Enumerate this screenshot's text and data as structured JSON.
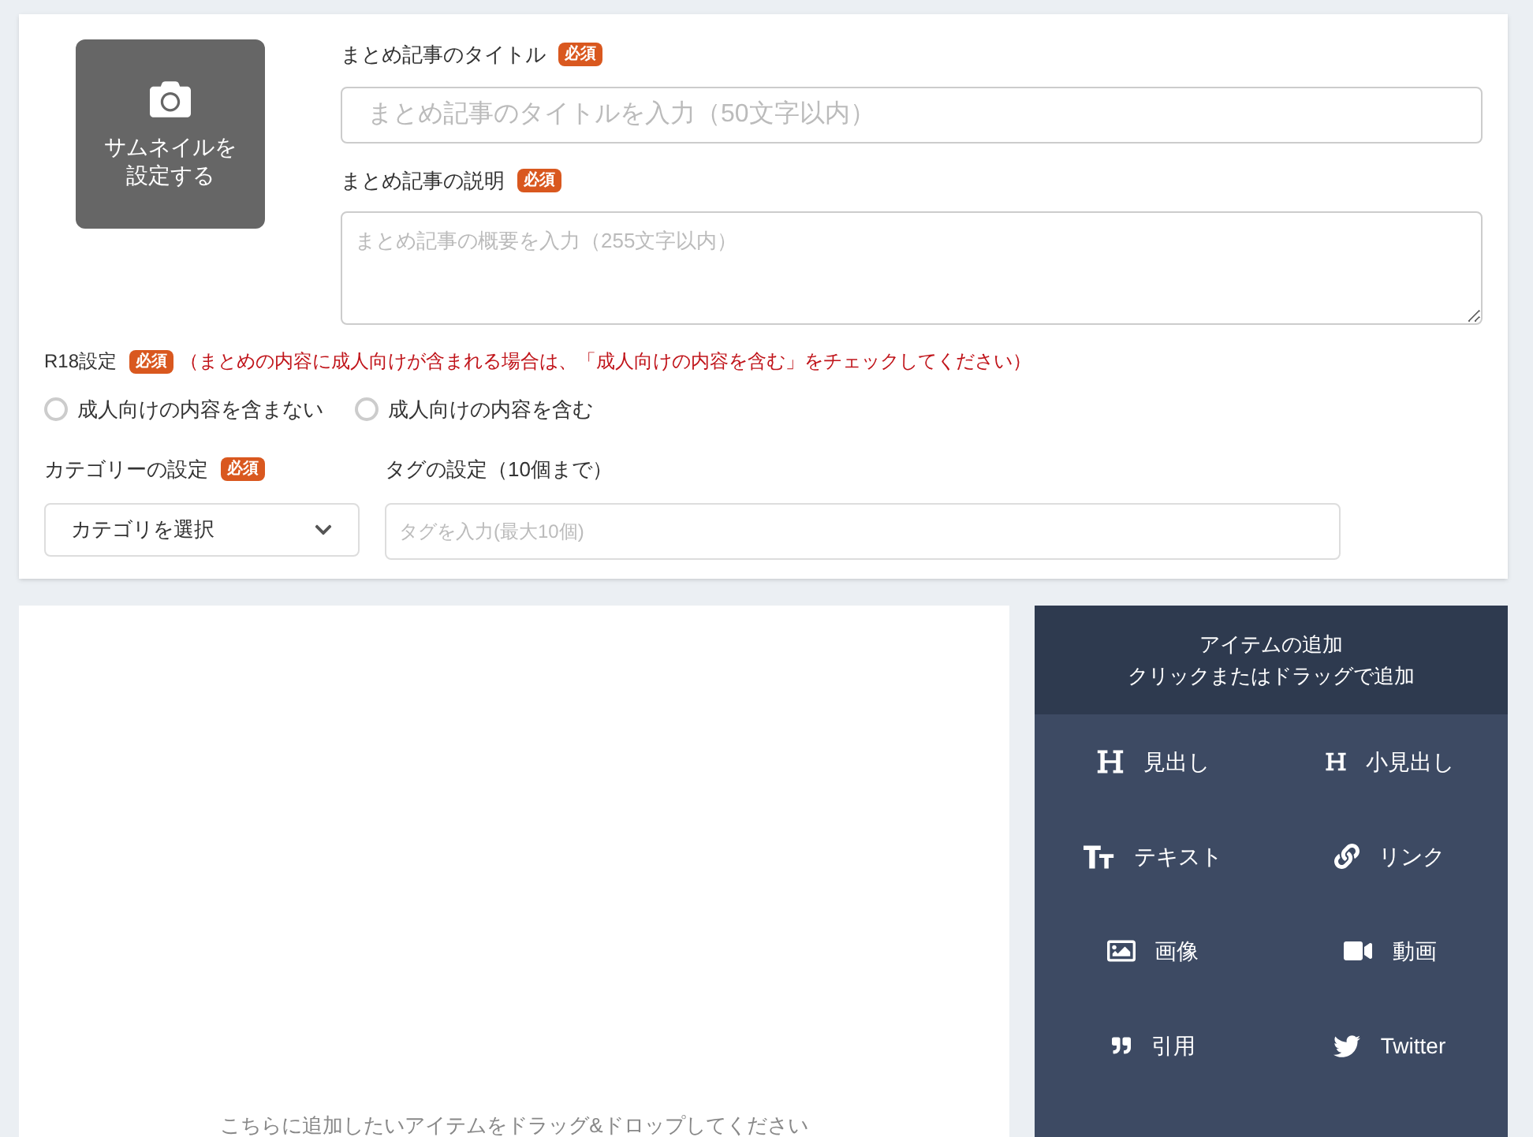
{
  "thumbnail": {
    "label_lines": [
      "サムネイルを",
      "設定する"
    ]
  },
  "title_field": {
    "label": "まとめ記事のタイトル",
    "badge": "必須",
    "placeholder": "まとめ記事のタイトルを入力（50文字以内）"
  },
  "description_field": {
    "label": "まとめ記事の説明",
    "badge": "必須",
    "placeholder": "まとめ記事の概要を入力（255文字以内）"
  },
  "r18": {
    "label": "R18設定",
    "badge": "必須",
    "note": "（まとめの内容に成人向けが含まれる場合は、「成人向けの内容を含む」をチェックしてください）",
    "options": [
      {
        "label": "成人向けの内容を含まない",
        "selected": false
      },
      {
        "label": "成人向けの内容を含む",
        "selected": false
      }
    ]
  },
  "category": {
    "label": "カテゴリーの設定",
    "badge": "必須",
    "value": "カテゴリを選択"
  },
  "tags": {
    "label": "タグの設定（10個まで）",
    "placeholder": "タグを入力(最大10個)"
  },
  "canvas": {
    "hint": "こちらに追加したいアイテムをドラッグ&ドロップしてください"
  },
  "item_panel": {
    "title": "アイテムの追加",
    "subtitle": "クリックまたはドラッグで追加",
    "items": [
      {
        "kind": "heading",
        "label": "見出し"
      },
      {
        "kind": "subheading",
        "label": "小見出し"
      },
      {
        "kind": "text",
        "label": "テキスト"
      },
      {
        "kind": "link",
        "label": "リンク"
      },
      {
        "kind": "image",
        "label": "画像"
      },
      {
        "kind": "video",
        "label": "動画"
      },
      {
        "kind": "quote",
        "label": "引用"
      },
      {
        "kind": "twitter",
        "label": "Twitter"
      }
    ]
  }
}
